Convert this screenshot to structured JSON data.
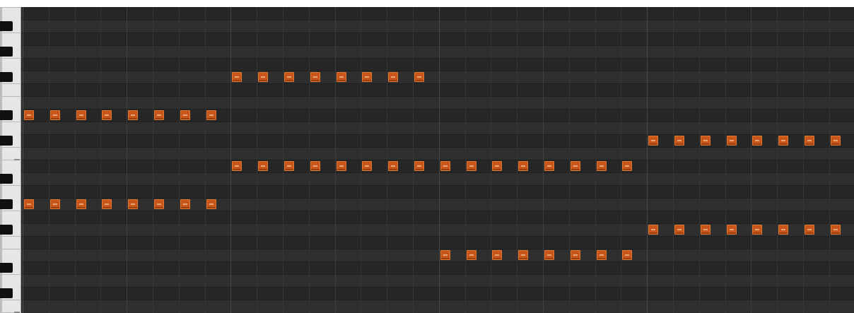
{
  "piano_roll": {
    "background_color": "#2a2a2a",
    "note_color": "#c8561b",
    "visible_pitch_rows": 24,
    "steps_per_bar": 8,
    "visible_bars": 4
  },
  "notes": [
    {
      "row": 5,
      "step": 8
    },
    {
      "row": 5,
      "step": 9
    },
    {
      "row": 5,
      "step": 10
    },
    {
      "row": 5,
      "step": 11
    },
    {
      "row": 5,
      "step": 12
    },
    {
      "row": 5,
      "step": 13
    },
    {
      "row": 5,
      "step": 14
    },
    {
      "row": 5,
      "step": 15
    },
    {
      "row": 8,
      "step": 0
    },
    {
      "row": 8,
      "step": 1
    },
    {
      "row": 8,
      "step": 2
    },
    {
      "row": 8,
      "step": 3
    },
    {
      "row": 8,
      "step": 4
    },
    {
      "row": 8,
      "step": 5
    },
    {
      "row": 8,
      "step": 6
    },
    {
      "row": 8,
      "step": 7
    },
    {
      "row": 10,
      "step": 24
    },
    {
      "row": 10,
      "step": 25
    },
    {
      "row": 10,
      "step": 26
    },
    {
      "row": 10,
      "step": 27
    },
    {
      "row": 10,
      "step": 28
    },
    {
      "row": 10,
      "step": 29
    },
    {
      "row": 10,
      "step": 30
    },
    {
      "row": 10,
      "step": 31
    },
    {
      "row": 12,
      "step": 8
    },
    {
      "row": 12,
      "step": 9
    },
    {
      "row": 12,
      "step": 10
    },
    {
      "row": 12,
      "step": 11
    },
    {
      "row": 12,
      "step": 12
    },
    {
      "row": 12,
      "step": 13
    },
    {
      "row": 12,
      "step": 14
    },
    {
      "row": 12,
      "step": 15
    },
    {
      "row": 12,
      "step": 16
    },
    {
      "row": 12,
      "step": 17
    },
    {
      "row": 12,
      "step": 18
    },
    {
      "row": 12,
      "step": 19
    },
    {
      "row": 12,
      "step": 20
    },
    {
      "row": 12,
      "step": 21
    },
    {
      "row": 12,
      "step": 22
    },
    {
      "row": 12,
      "step": 23
    },
    {
      "row": 15,
      "step": 0
    },
    {
      "row": 15,
      "step": 1
    },
    {
      "row": 15,
      "step": 2
    },
    {
      "row": 15,
      "step": 3
    },
    {
      "row": 15,
      "step": 4
    },
    {
      "row": 15,
      "step": 5
    },
    {
      "row": 15,
      "step": 6
    },
    {
      "row": 15,
      "step": 7
    },
    {
      "row": 17,
      "step": 24
    },
    {
      "row": 17,
      "step": 25
    },
    {
      "row": 17,
      "step": 26
    },
    {
      "row": 17,
      "step": 27
    },
    {
      "row": 17,
      "step": 28
    },
    {
      "row": 17,
      "step": 29
    },
    {
      "row": 17,
      "step": 30
    },
    {
      "row": 17,
      "step": 31
    },
    {
      "row": 19,
      "step": 16
    },
    {
      "row": 19,
      "step": 17
    },
    {
      "row": 19,
      "step": 18
    },
    {
      "row": 19,
      "step": 19
    },
    {
      "row": 19,
      "step": 20
    },
    {
      "row": 19,
      "step": 21
    },
    {
      "row": 19,
      "step": 22
    },
    {
      "row": 19,
      "step": 23
    }
  ]
}
